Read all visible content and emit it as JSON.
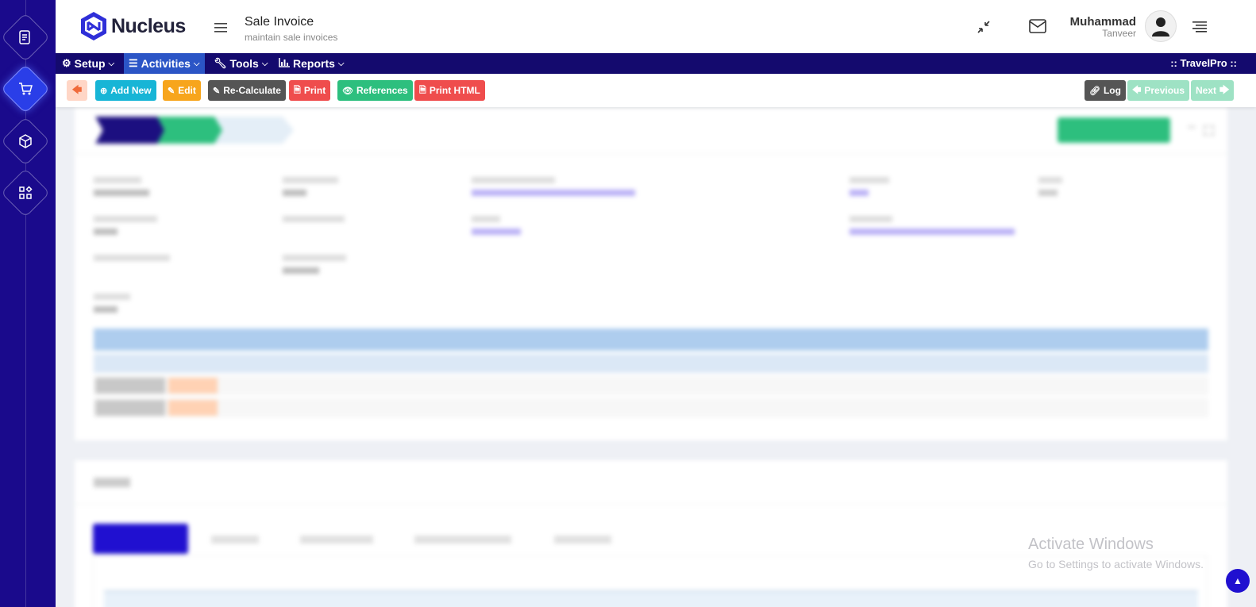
{
  "app": {
    "name": "Nucleus"
  },
  "page": {
    "title": "Sale Invoice",
    "subtitle": "maintain sale invoices"
  },
  "user": {
    "first": "Muhammad",
    "last": "Tanveer"
  },
  "menu": {
    "items": [
      {
        "label": "Setup",
        "icon": "gear-icon"
      },
      {
        "label": "Activities",
        "icon": "list-icon"
      },
      {
        "label": "Tools",
        "icon": "wrench-icon"
      },
      {
        "label": "Reports",
        "icon": "bar-chart-icon"
      }
    ],
    "brand": ":: TravelPro ::"
  },
  "toolbar": {
    "add_new": "Add New",
    "edit": "Edit",
    "recalculate": "Re-Calculate",
    "print": "Print",
    "references": "References",
    "print_html": "Print HTML",
    "log": "Log",
    "previous": "Previous",
    "next": "Next"
  },
  "colors": {
    "rail": "#1a0a8c",
    "menubar": "#140a6e",
    "menu_active": "#2b55c6",
    "add_new": "#17b5d6",
    "edit": "#f7a51c",
    "recalculate": "#555555",
    "print": "#ef4d4d",
    "references": "#2dbf7e",
    "log": "#555555",
    "previous": "#9ee2c4",
    "next": "#9ee2c4"
  },
  "watermark": {
    "title": "Activate Windows",
    "subtitle": "Go to Settings to activate Windows."
  }
}
